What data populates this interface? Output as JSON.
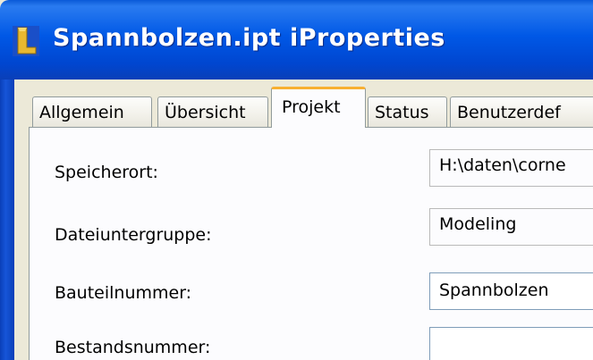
{
  "window": {
    "title": "Spannbolzen.ipt iProperties"
  },
  "tabs": [
    {
      "label": "Allgemein"
    },
    {
      "label": "Übersicht"
    },
    {
      "label": "Projekt"
    },
    {
      "label": "Status"
    },
    {
      "label": "Benutzerdef"
    }
  ],
  "active_tab": "Projekt",
  "form": {
    "speicherort_label": "Speicherort:",
    "speicherort_value": "H:\\daten\\corne",
    "dateiuntergruppe_label": "Dateiuntergruppe:",
    "dateiuntergruppe_value": "Modeling",
    "bauteilnummer_label": "Bauteilnummer:",
    "bauteilnummer_value": "Spannbolzen",
    "bestandsnummer_label": "Bestandsnummer:",
    "bestandsnummer_value": ""
  },
  "colors": {
    "titlebar": "#0058e6",
    "active_tab_highlight": "#f8b032",
    "dialog_background": "#ece9d8"
  },
  "icons": {
    "app": "inventor-app-icon"
  }
}
